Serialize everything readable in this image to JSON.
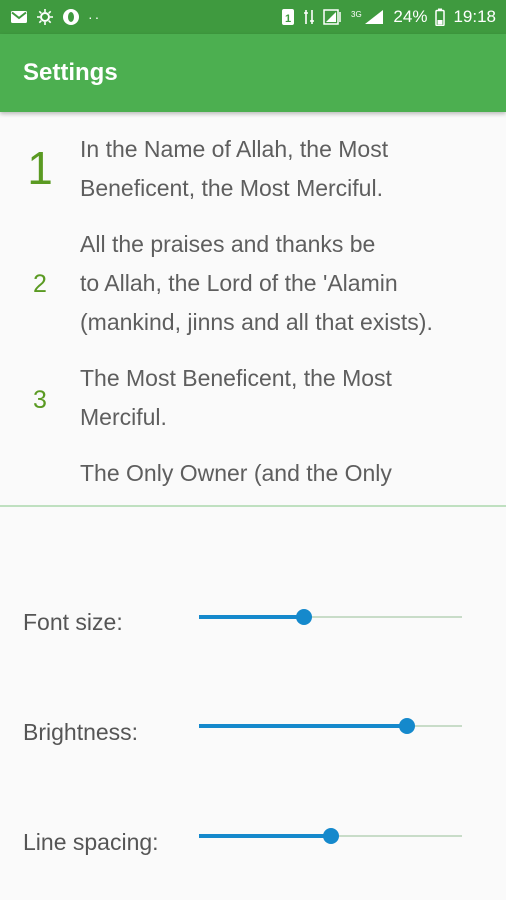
{
  "status_bar": {
    "icons_left": [
      "gmail-icon",
      "sync-icon",
      "opera-icon"
    ],
    "dots": "··",
    "sim_badge": "1",
    "network_type": "3G",
    "battery": "24%",
    "time": "19:18"
  },
  "app_bar": {
    "title": "Settings",
    "color": "#4caf50"
  },
  "preview": {
    "verses": [
      {
        "number": "1",
        "text": "In the Name of Allah, the Most\nBeneficent, the Most Merciful."
      },
      {
        "number": "2",
        "text": "All the praises and thanks be\nto Allah, the Lord of the 'Alamin\n(mankind, jinns and all that exists)."
      },
      {
        "number": "3",
        "text": "The Most Beneficent, the Most\nMerciful."
      },
      {
        "number": "",
        "text": "The Only Owner (and the Only"
      }
    ],
    "number_color": "#5a9a22"
  },
  "settings": [
    {
      "label": "Font size:",
      "value": 0.4
    },
    {
      "label": "Brightness:",
      "value": 0.79
    },
    {
      "label": "Line spacing:",
      "value": 0.5
    }
  ],
  "accent_color": "#1589cc"
}
